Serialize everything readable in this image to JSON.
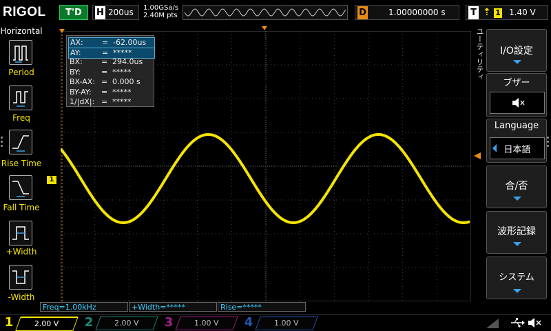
{
  "header": {
    "logo": "RIGOL",
    "trigger_status": "T'D",
    "horizontal_letter": "H",
    "timebase": "200us",
    "sample_rate": "1.00GSa/s",
    "memory_points": "2.40M pts",
    "delay_letter": "D",
    "delay_value": "1.00000000 s",
    "trigger_letter": "T",
    "trigger_source": "1",
    "trigger_level": "1.40 V"
  },
  "left_panel": {
    "title": "Horizontal",
    "items": [
      {
        "label": "Period",
        "icon": "period-icon"
      },
      {
        "label": "Freq",
        "icon": "frequency-icon"
      },
      {
        "label": "Rise Time",
        "icon": "rise-time-icon"
      },
      {
        "label": "Fall Time",
        "icon": "fall-time-icon"
      },
      {
        "label": "+Width",
        "icon": "positive-width-icon"
      },
      {
        "label": "-Width",
        "icon": "negative-width-icon"
      }
    ]
  },
  "cursor_table": {
    "rows": [
      {
        "key": "AX:",
        "eq": "=",
        "value": "-62.00us",
        "highlight": true
      },
      {
        "key": "AY:",
        "eq": "=",
        "value": "*****",
        "highlight": true
      },
      {
        "key": "BX:",
        "eq": "=",
        "value": "294.0us",
        "highlight": false
      },
      {
        "key": "BY:",
        "eq": "=",
        "value": "*****",
        "highlight": false
      },
      {
        "key": "BX-AX:",
        "eq": "=",
        "value": "0.000 s",
        "highlight": false
      },
      {
        "key": "BY-AY:",
        "eq": "=",
        "value": "*****",
        "highlight": false
      },
      {
        "key": "1/|dX|:",
        "eq": "=",
        "value": "*****",
        "highlight": false
      }
    ]
  },
  "channel1_marker": "1",
  "right_menu": {
    "vertical_title": "ユーティリティ",
    "io_label": "I/O設定",
    "buzzer_title": "ブザー",
    "buzzer_icon": "speaker-mute-icon",
    "language_title": "Language",
    "language_value": "日本語",
    "passfail_label": "合/否",
    "wave_record_label": "波形記録",
    "system_label": "システム"
  },
  "measurements": {
    "freq": "Freq=1.00kHz",
    "width": "+Width=*****",
    "rise": "Rise=*****"
  },
  "channels": [
    {
      "num": "1",
      "value": "2.00 V",
      "color": "#f5e400",
      "active": true
    },
    {
      "num": "2",
      "value": "2.00 V",
      "color": "#1a8a7a",
      "active": false
    },
    {
      "num": "3",
      "value": "1.00 V",
      "color": "#a0208a",
      "active": false
    },
    {
      "num": "4",
      "value": "1.00 V",
      "color": "#2456b0",
      "active": false
    }
  ],
  "status_icons": [
    "usb-icon",
    "sound-mute-icon"
  ],
  "colors": {
    "ch1": "#f5e400",
    "cursor_marker": "#e98a16",
    "accent_blue": "#3aa0e8",
    "measure_text": "#3ad0ff"
  }
}
